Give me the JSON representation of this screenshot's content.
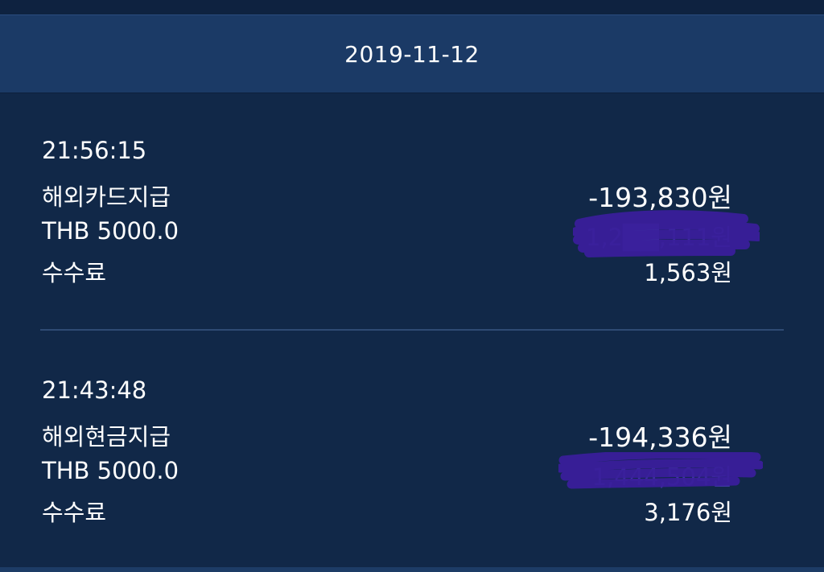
{
  "date_header": {
    "date": "2019-11-12"
  },
  "transactions": [
    {
      "time": "21:56:15",
      "type": "해외카드지급",
      "amount": "-193,830원",
      "currency_line": "THB 5000.0",
      "redacted_value": "1,2██,111원",
      "fee_label": "수수료",
      "fee": "1,563원"
    },
    {
      "time": "21:43:48",
      "type": "해외현금지급",
      "amount": "-194,336원",
      "currency_line": "THB 5000.0",
      "redacted_value": "1,444,504원",
      "fee_label": "수수료",
      "fee": "3,176원"
    }
  ],
  "colors": {
    "background": "#112848",
    "header": "#1b3a66",
    "divider": "#2e4a73",
    "redaction_ink": "#3a1e9c"
  }
}
